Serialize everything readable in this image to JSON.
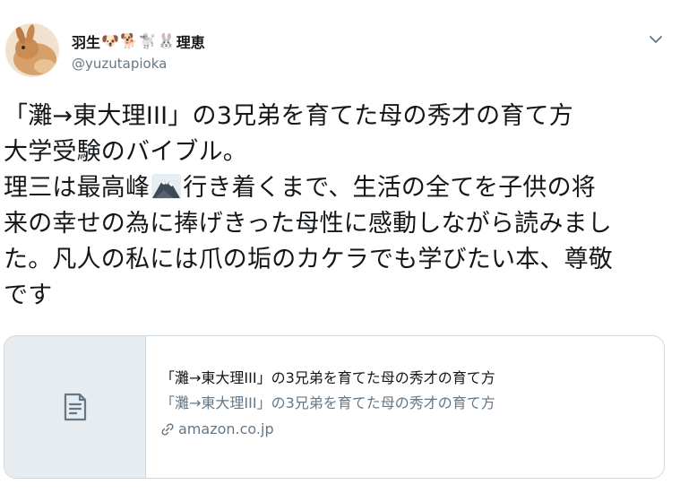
{
  "author": {
    "name_prefix": "羽生",
    "emojis": [
      "🐶",
      "🐕",
      "🐩",
      "🐰"
    ],
    "name_suffix": "理恵",
    "handle": "@yuzutapioka"
  },
  "tweet": {
    "lines": [
      "「灘→東大理III」の3兄弟を育てた母の秀才の育て方",
      "大学受験のバイブル。",
      "理三は最高峰",
      "行き着くまで、生活の全てを子供の将",
      "来の幸せの為に捧げきった母性に感動しながら読みまし",
      "た。凡人の私には爪の垢のカケラでも学びたい本、尊敬",
      "です"
    ],
    "inline_icon": "mountain-icon"
  },
  "card": {
    "title": "「灘→東大理III」の3兄弟を育てた母の秀才の育て方",
    "description": "「灘→東大理III」の3兄弟を育てた母の秀才の育て方",
    "domain": "amazon.co.jp",
    "thumbnail_icon": "document-icon"
  },
  "colors": {
    "text": "#14171a",
    "secondary": "#657786",
    "border": "#d1d9de",
    "thumb_bg": "#e6ecf0"
  }
}
